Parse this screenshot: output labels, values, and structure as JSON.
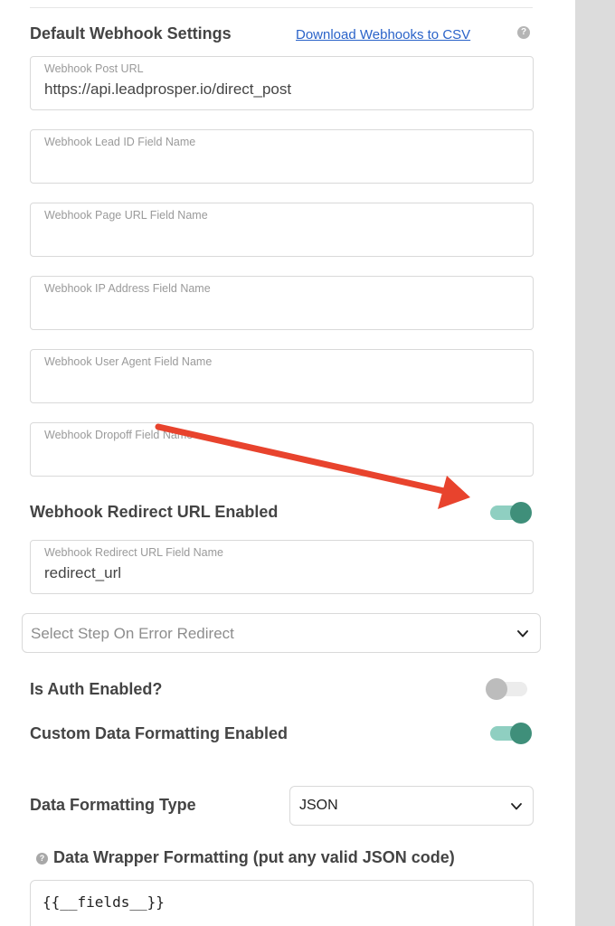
{
  "header": {
    "title": "Default Webhook Settings",
    "download_link": "Download Webhooks to CSV",
    "help_glyph": "?"
  },
  "fields": {
    "post_url": {
      "label": "Webhook Post URL",
      "value": "https://api.leadprosper.io/direct_post"
    },
    "lead_id": {
      "label": "Webhook Lead ID Field Name",
      "value": ""
    },
    "page_url": {
      "label": "Webhook Page URL Field Name",
      "value": ""
    },
    "ip_address": {
      "label": "Webhook IP Address Field Name",
      "value": ""
    },
    "user_agent": {
      "label": "Webhook User Agent Field Name",
      "value": ""
    },
    "dropoff": {
      "label": "Webhook Dropoff Field Name",
      "value": ""
    },
    "redirect_url_field": {
      "label": "Webhook Redirect URL Field Name",
      "value": "redirect_url"
    }
  },
  "toggles": {
    "redirect_enabled": {
      "label": "Webhook Redirect URL Enabled",
      "on": true
    },
    "auth_enabled": {
      "label": "Is Auth Enabled?",
      "on": false
    },
    "custom_formatting": {
      "label": "Custom Data Formatting Enabled",
      "on": true
    }
  },
  "selects": {
    "error_redirect": {
      "placeholder": "Select Step On Error Redirect"
    },
    "formatting_type": {
      "label": "Data Formatting Type",
      "value": "JSON"
    }
  },
  "wrapper": {
    "label": "Data Wrapper Formatting (put any valid JSON code)",
    "help_glyph": "?",
    "code": "{{__fields__}}"
  },
  "colors": {
    "accent_teal": "#3f8f7a",
    "link_blue": "#2a63c9",
    "annotation_arrow": "#e8432d"
  },
  "icons": [
    "help-icon",
    "chevron-down-icon",
    "annotation-arrow"
  ]
}
